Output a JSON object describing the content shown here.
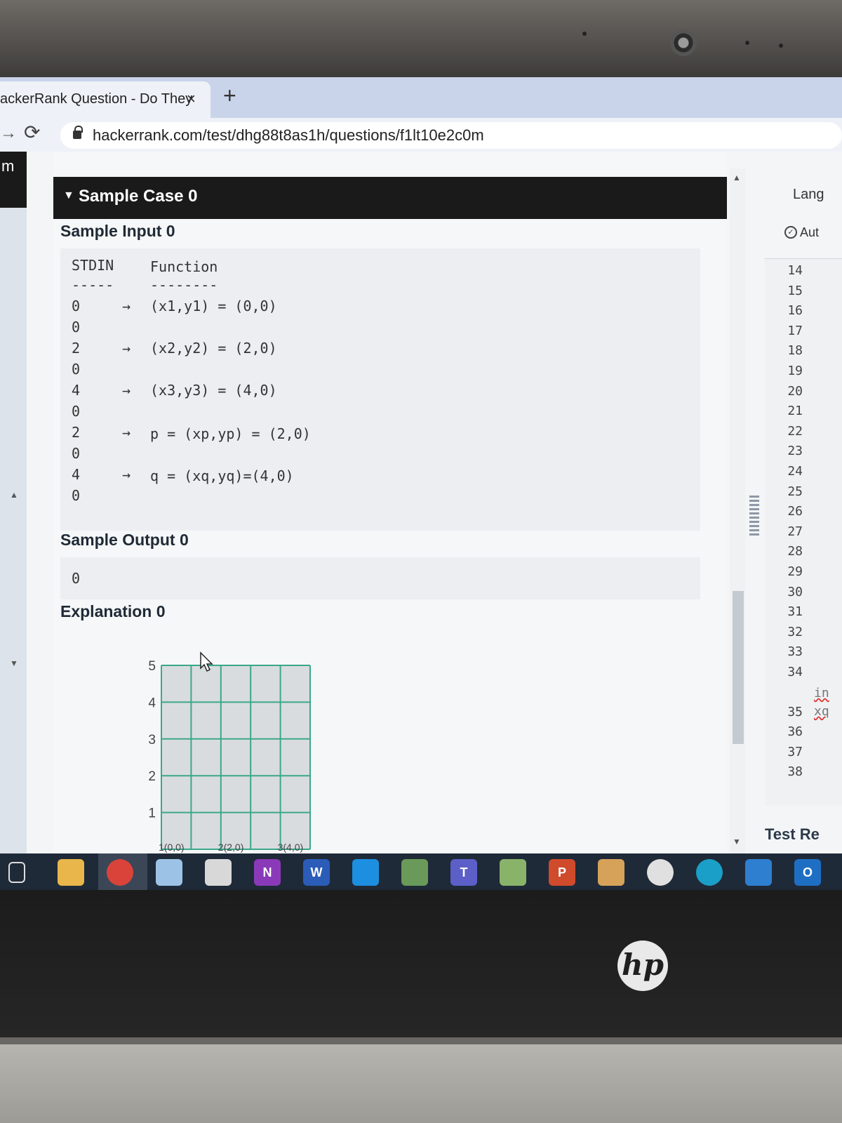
{
  "browser": {
    "tab_title": "ackerRank Question - Do They",
    "tab_close": "×",
    "new_tab": "+",
    "url": "hackerrank.com/test/dhg88t8as1h/questions/f1lt10e2c0m"
  },
  "rail": {
    "logo": "m"
  },
  "sample_case": {
    "title": "Sample Case 0",
    "input_label": "Sample Input 0",
    "stdin_header": "STDIN",
    "function_header": "Function",
    "stdin_sep": "-----",
    "function_sep": "--------",
    "stdin_values": [
      "0",
      "0",
      "2",
      "0",
      "4",
      "0",
      "2",
      "0",
      "4",
      "0"
    ],
    "arrow": "→",
    "functions": [
      "(x1,y1) = (0,0)",
      "(x2,y2) = (2,0)",
      "(x3,y3) = (4,0)",
      "p = (xp,yp) = (2,0)",
      "q = (xq,yq)=(4,0)"
    ],
    "output_label": "Sample Output 0",
    "output_value": "0",
    "explanation_label": "Explanation 0"
  },
  "chart_data": {
    "type": "scatter",
    "title": "",
    "xlabel": "",
    "ylabel": "",
    "y_ticks": [
      "5",
      "4",
      "3",
      "2",
      "1"
    ],
    "x_labels": [
      "1(0,0)",
      "2(2,0)",
      "3(4,0)"
    ],
    "grid": true,
    "grid_color": "#3aa88a"
  },
  "editor": {
    "language_label": "Lang",
    "auto_label": "Aut",
    "line_numbers": [
      "14",
      "15",
      "16",
      "17",
      "18",
      "19",
      "20",
      "21",
      "22",
      "23",
      "24",
      "25",
      "26",
      "27",
      "28",
      "29",
      "30",
      "31",
      "32",
      "33",
      "34",
      "35",
      "36",
      "37",
      "38"
    ],
    "code_fragments": [
      "in",
      "xq"
    ],
    "test_results": "Test Re"
  },
  "taskbar": {
    "icons": [
      {
        "name": "task-view-icon",
        "color": "#1f2a38",
        "label": ""
      },
      {
        "name": "file-explorer-icon",
        "color": "#e8b64a",
        "label": ""
      },
      {
        "name": "chrome-icon",
        "color": "#d9433a",
        "label": ""
      },
      {
        "name": "notepad-icon",
        "color": "#9cc3e6",
        "label": ""
      },
      {
        "name": "paint-icon",
        "color": "#d8d8d8",
        "label": ""
      },
      {
        "name": "onenote-icon",
        "color": "#8a3ab8",
        "label": "N"
      },
      {
        "name": "word-icon",
        "color": "#2b5cb8",
        "label": "W"
      },
      {
        "name": "vscode-icon",
        "color": "#1d8fe0",
        "label": ""
      },
      {
        "name": "app-icon",
        "color": "#6a9a5a",
        "label": ""
      },
      {
        "name": "teams-icon",
        "color": "#5b5fc7",
        "label": "T"
      },
      {
        "name": "app-icon-2",
        "color": "#8ab36a",
        "label": ""
      },
      {
        "name": "powerpoint-icon",
        "color": "#d04a2c",
        "label": "P"
      },
      {
        "name": "app-icon-3",
        "color": "#d6a25a",
        "label": ""
      },
      {
        "name": "soccer-icon",
        "color": "#e0e0e0",
        "label": ""
      },
      {
        "name": "edge-icon",
        "color": "#1aa0c8",
        "label": ""
      },
      {
        "name": "photos-icon",
        "color": "#2f7fd0",
        "label": ""
      },
      {
        "name": "outlook-icon",
        "color": "#1e6fc4",
        "label": "O"
      }
    ]
  }
}
